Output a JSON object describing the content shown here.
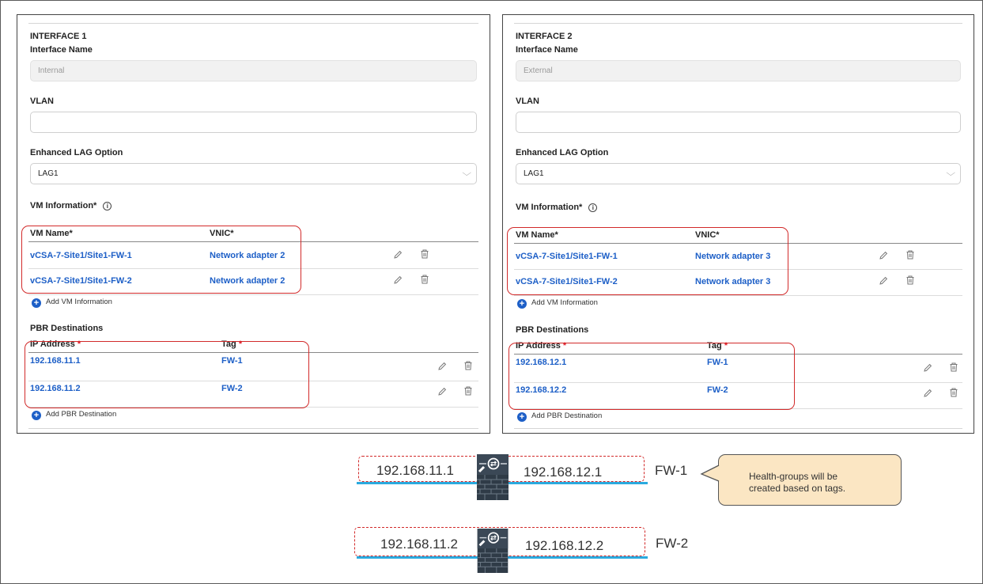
{
  "interfaces": [
    {
      "title": "INTERFACE 1",
      "name_label": "Interface Name",
      "name_value": "Internal",
      "vlan_label": "VLAN",
      "vlan_value": "",
      "lag_label": "Enhanced LAG Option",
      "lag_value": "LAG1",
      "vm_info_label": "VM Information*",
      "vm_col_name": "VM Name*",
      "vm_col_vnic": "VNIC*",
      "vm_rows": [
        {
          "name": "vCSA-7-Site1/Site1-FW-1",
          "vnic": "Network adapter 2"
        },
        {
          "name": "vCSA-7-Site1/Site1-FW-2",
          "vnic": "Network adapter 2"
        }
      ],
      "add_vm_label": "Add VM Information",
      "pbr_label": "PBR Destinations",
      "pbr_col_ip": "IP Address",
      "pbr_col_tag": "Tag",
      "required_mark": "*",
      "pbr_rows": [
        {
          "ip": "192.168.11.1",
          "tag": "FW-1"
        },
        {
          "ip": "192.168.11.2",
          "tag": "FW-2"
        }
      ],
      "add_pbr_label": "Add PBR Destination"
    },
    {
      "title": "INTERFACE 2",
      "name_label": "Interface Name",
      "name_value": "External",
      "vlan_label": "VLAN",
      "vlan_value": "",
      "lag_label": "Enhanced LAG Option",
      "lag_value": "LAG1",
      "vm_info_label": "VM Information*",
      "vm_col_name": "VM Name*",
      "vm_col_vnic": "VNIC*",
      "vm_rows": [
        {
          "name": "vCSA-7-Site1/Site1-FW-1",
          "vnic": "Network adapter 3"
        },
        {
          "name": "vCSA-7-Site1/Site1-FW-2",
          "vnic": "Network adapter 3"
        }
      ],
      "add_vm_label": "Add VM Information",
      "pbr_label": "PBR Destinations",
      "pbr_col_ip": "IP Address",
      "pbr_col_tag": "Tag",
      "required_mark": "*",
      "pbr_rows": [
        {
          "ip": "192.168.12.1",
          "tag": "FW-1"
        },
        {
          "ip": "192.168.12.2",
          "tag": "FW-2"
        }
      ],
      "add_pbr_label": "Add PBR Destination"
    }
  ],
  "diagram": {
    "firewalls": [
      {
        "left_ip": "192.168.11.1",
        "right_ip": "192.168.12.1",
        "label": "FW-1"
      },
      {
        "left_ip": "192.168.11.2",
        "right_ip": "192.168.12.2",
        "label": "FW-2"
      }
    ],
    "callout_line1": "Health-groups will be",
    "callout_line2": "created based on tags."
  },
  "icons": {
    "edit": "pencil-icon",
    "delete": "trash-icon",
    "info": "info-icon",
    "add": "plus-circle-icon",
    "firewall": "firewall-icon"
  },
  "colors": {
    "link": "#1d5fc7",
    "highlight": "#d22a2a",
    "network_line": "#2aaadf",
    "callout_fill": "#fbe6c3"
  }
}
